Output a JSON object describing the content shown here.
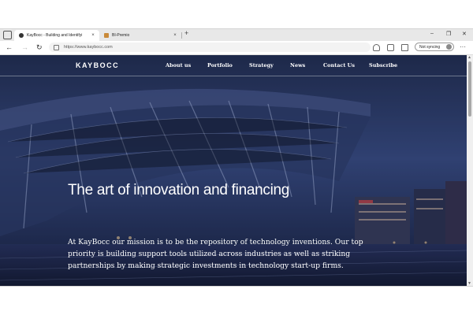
{
  "browser": {
    "tabs": [
      {
        "title": "KayBocc - Building and Identifyi",
        "active": true
      },
      {
        "title": "BI-Premio",
        "active": false
      }
    ],
    "new_tab_symbol": "+",
    "close_symbol": "×",
    "window_controls": {
      "minimize": "–",
      "restore": "❐",
      "close": "✕"
    },
    "nav": {
      "back": "←",
      "forward": "→",
      "reload": "↻"
    },
    "url": "https://www.kaybocc.com",
    "profile_label": "Not syncing",
    "more_menu": "···",
    "icons": [
      "star-icon",
      "favorites-icon",
      "collections-icon"
    ]
  },
  "site": {
    "logo": "KAYBOCC",
    "nav": [
      "About us",
      "Portfolio",
      "Strategy",
      "News",
      "Contact Us",
      "Subscribe"
    ],
    "hero_title": "The art of innovation and financing",
    "hero_text": "At KayBocc our mission is to be the repository of technology inventions. Our top priority is building support tools utilized across industries as well as striking partnerships by making strategic investments in technology start-up firms."
  },
  "colors": {
    "hero_bg": "#2d3a66",
    "tab_strip": "#e8e8e8"
  }
}
